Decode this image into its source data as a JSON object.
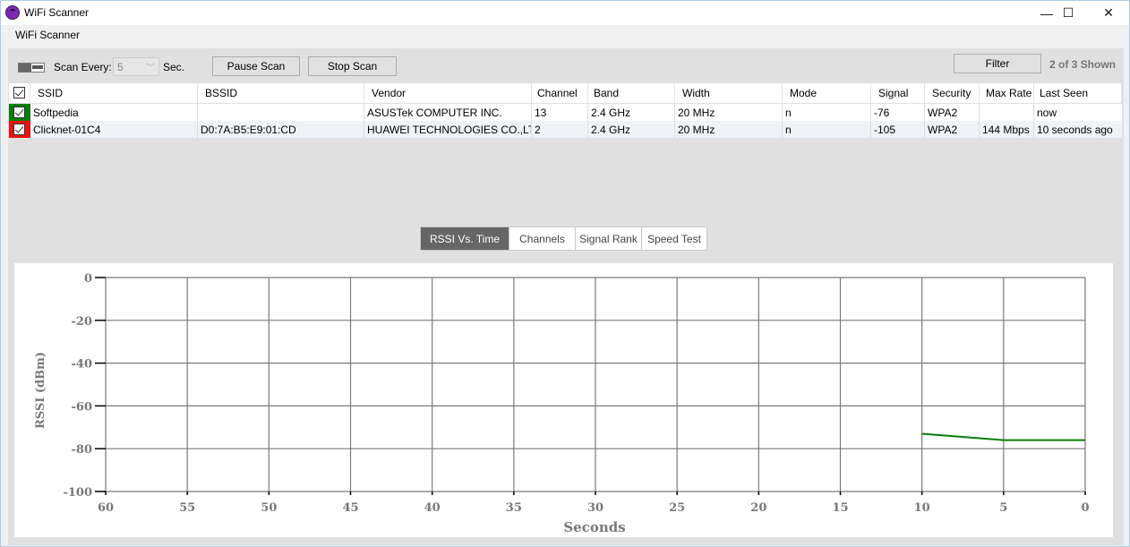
{
  "window": {
    "title": "WiFi Scanner",
    "controls": {
      "minimize": "—",
      "maximize": "☐",
      "close": "✕"
    }
  },
  "menu": {
    "items": [
      "WiFi Scanner"
    ]
  },
  "toolbar": {
    "scan_every_label": "Scan Every:",
    "scan_interval": "5",
    "sec_label": "Sec.",
    "pause_label": "Pause Scan",
    "stop_label": "Stop Scan",
    "filter_label": "Filter",
    "shown_text": "2 of 3 Shown"
  },
  "table": {
    "columns": [
      "SSID",
      "BSSID",
      "Vendor",
      "Channel",
      "Band",
      "Width",
      "Mode",
      "Signal",
      "Security",
      "Max Rate",
      "Last Seen"
    ],
    "rows": [
      {
        "color": "#0a7d0a",
        "checked": true,
        "cells": [
          "Softpedia",
          "",
          "ASUSTek COMPUTER INC.",
          "13",
          "2.4 GHz",
          "20 MHz",
          "n",
          "-76",
          "WPA2",
          "",
          "now"
        ]
      },
      {
        "color": "#ee1111",
        "checked": true,
        "cells": [
          "Clicknet-01C4",
          "D0:7A:B5:E9:01:CD",
          "HUAWEI TECHNOLOGIES CO.,LTD",
          "2",
          "2.4 GHz",
          "20 MHz",
          "n",
          "-105",
          "WPA2",
          "144 Mbps",
          "10 seconds ago"
        ]
      }
    ]
  },
  "tabs": [
    {
      "label": "RSSI Vs. Time",
      "active": true
    },
    {
      "label": "Channels",
      "active": false
    },
    {
      "label": "Signal Rank",
      "active": false
    },
    {
      "label": "Speed Test",
      "active": false
    }
  ],
  "chart_data": {
    "type": "line",
    "title": "",
    "xlabel": "Seconds",
    "ylabel": "RSSI (dBm)",
    "xlim": [
      60,
      0
    ],
    "ylim": [
      0,
      -100
    ],
    "x_ticks": [
      60,
      55,
      50,
      45,
      40,
      35,
      30,
      25,
      20,
      15,
      10,
      5,
      0
    ],
    "y_ticks": [
      0,
      -20,
      -40,
      -60,
      -80,
      -100
    ],
    "grid": true,
    "series": [
      {
        "name": "Softpedia",
        "color": "#0a7d0a",
        "x": [
          10,
          5,
          0
        ],
        "y": [
          -73,
          -76,
          -76
        ]
      }
    ]
  }
}
